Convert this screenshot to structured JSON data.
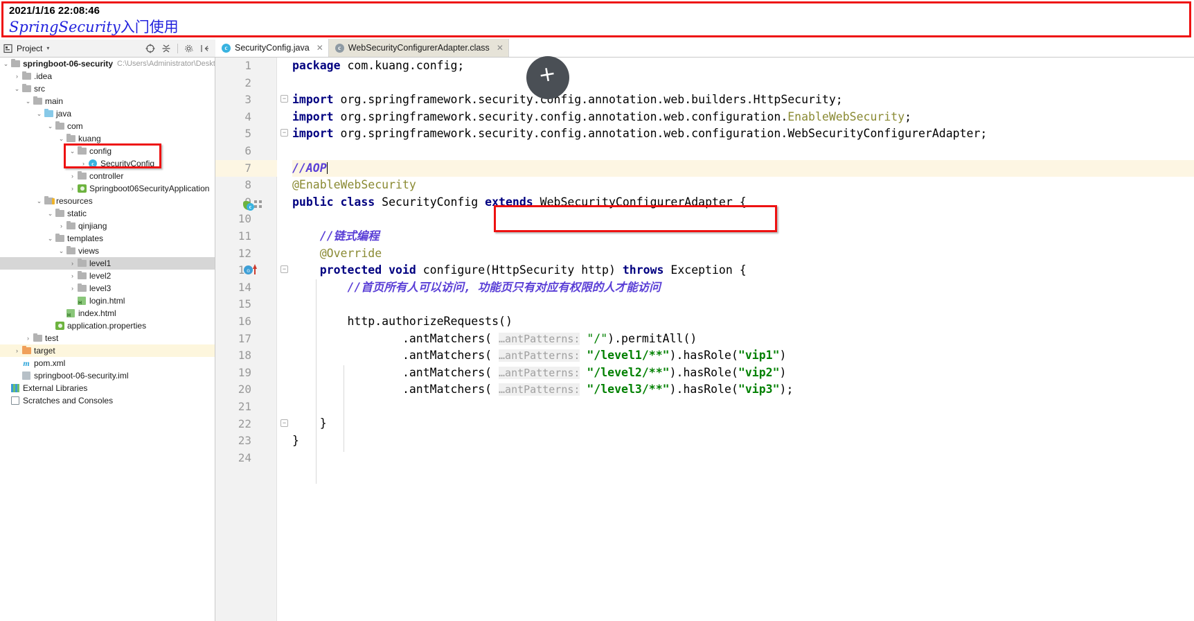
{
  "annotation": {
    "timestamp": "2021/1/16 22:08:46",
    "title_latin": "SpringSecurity",
    "title_cjk": "入门使用",
    "box_color": "#ee1111"
  },
  "project_panel": {
    "title": "Project",
    "caret": "▾",
    "toolbar_icons": [
      "target-icon",
      "collapse-all-icon",
      "settings-icon",
      "hide-icon"
    ],
    "tree": [
      {
        "depth": 0,
        "arrow": "v",
        "icon": "module-icon",
        "label": "springboot-06-security",
        "bold": true,
        "path": "C:\\Users\\Administrator\\Desktop\\"
      },
      {
        "depth": 1,
        "arrow": ">",
        "icon": "folder-icon",
        "label": ".idea"
      },
      {
        "depth": 1,
        "arrow": "v",
        "icon": "folder-icon",
        "label": "src"
      },
      {
        "depth": 2,
        "arrow": "v",
        "icon": "folder-icon",
        "label": "main"
      },
      {
        "depth": 3,
        "arrow": "v",
        "icon": "folder-blue-icon",
        "label": "java"
      },
      {
        "depth": 4,
        "arrow": "v",
        "icon": "folder-icon",
        "label": "com"
      },
      {
        "depth": 5,
        "arrow": "v",
        "icon": "folder-icon",
        "label": "kuang"
      },
      {
        "depth": 6,
        "arrow": "v",
        "icon": "folder-icon",
        "label": "config"
      },
      {
        "depth": 7,
        "arrow": ">",
        "icon": "java-class-icon",
        "label": "SecurityConfig"
      },
      {
        "depth": 6,
        "arrow": ">",
        "icon": "folder-icon",
        "label": "controller"
      },
      {
        "depth": 6,
        "arrow": ">",
        "icon": "spring-boot-icon",
        "label": "Springboot06SecurityApplication"
      },
      {
        "depth": 3,
        "arrow": "v",
        "icon": "resources-icon",
        "label": "resources"
      },
      {
        "depth": 4,
        "arrow": "v",
        "icon": "folder-icon",
        "label": "static"
      },
      {
        "depth": 5,
        "arrow": ">",
        "icon": "folder-icon",
        "label": "qinjiang"
      },
      {
        "depth": 4,
        "arrow": "v",
        "icon": "folder-icon",
        "label": "templates"
      },
      {
        "depth": 5,
        "arrow": "v",
        "icon": "folder-icon",
        "label": "views"
      },
      {
        "depth": 6,
        "arrow": ">",
        "icon": "folder-icon",
        "label": "level1",
        "selected": true
      },
      {
        "depth": 6,
        "arrow": ">",
        "icon": "folder-icon",
        "label": "level2"
      },
      {
        "depth": 6,
        "arrow": ">",
        "icon": "folder-icon",
        "label": "level3"
      },
      {
        "depth": 6,
        "arrow": "",
        "icon": "html-file-icon",
        "label": "login.html"
      },
      {
        "depth": 5,
        "arrow": "",
        "icon": "html-file-icon",
        "label": "index.html"
      },
      {
        "depth": 4,
        "arrow": "",
        "icon": "spring-properties-icon",
        "label": "application.properties"
      },
      {
        "depth": 2,
        "arrow": ">",
        "icon": "folder-icon",
        "label": "test"
      },
      {
        "depth": 1,
        "arrow": ">",
        "icon": "folder-orange-icon",
        "label": "target",
        "highlight": true
      },
      {
        "depth": 1,
        "arrow": "",
        "icon": "maven-icon",
        "label": "pom.xml"
      },
      {
        "depth": 1,
        "arrow": "",
        "icon": "iml-icon",
        "label": "springboot-06-security.iml"
      },
      {
        "depth": 0,
        "arrow": "",
        "icon": "external-libraries-icon",
        "label": "External Libraries"
      },
      {
        "depth": 0,
        "arrow": "",
        "icon": "scratches-icon",
        "label": "Scratches and Consoles"
      }
    ]
  },
  "tabs": [
    {
      "label": "SecurityConfig.java",
      "icon": "java-class-icon",
      "active": true,
      "closable": true
    },
    {
      "label": "WebSecurityConfigurerAdapter.class",
      "icon": "class-file-icon",
      "active": false,
      "closable": true
    }
  ],
  "editor": {
    "current_line": 7,
    "lines": [
      {
        "n": 1,
        "tokens": [
          {
            "t": "package ",
            "c": "kw"
          },
          {
            "t": "com.kuang.config;",
            "c": ""
          }
        ]
      },
      {
        "n": 2,
        "tokens": []
      },
      {
        "n": 3,
        "tokens": [
          {
            "t": "import ",
            "c": "kw"
          },
          {
            "t": "org.springframework.security.config.annotation.web.builders.HttpSecurity;",
            "c": ""
          }
        ]
      },
      {
        "n": 4,
        "tokens": [
          {
            "t": "import ",
            "c": "kw"
          },
          {
            "t": "org.springframework.security.config.annotation.web.configuration.",
            "c": ""
          },
          {
            "t": "EnableWebSecurity",
            "c": "ann"
          },
          {
            "t": ";",
            "c": ""
          }
        ]
      },
      {
        "n": 5,
        "tokens": [
          {
            "t": "import ",
            "c": "kw"
          },
          {
            "t": "org.springframework.security.config.annotation.web.configuration.WebSecurityConfigurerAdapter;",
            "c": ""
          }
        ]
      },
      {
        "n": 6,
        "tokens": []
      },
      {
        "n": 7,
        "tokens": [
          {
            "t": "//AOP",
            "c": "cmt-b"
          }
        ],
        "highlight": true,
        "caret": true
      },
      {
        "n": 8,
        "tokens": [
          {
            "t": "@EnableWebSecurity",
            "c": "ann"
          }
        ]
      },
      {
        "n": 9,
        "tokens": [
          {
            "t": "public ",
            "c": "kw"
          },
          {
            "t": "class ",
            "c": "kw"
          },
          {
            "t": "SecurityConfig ",
            "c": ""
          },
          {
            "t": "extends ",
            "c": "kw"
          },
          {
            "t": "WebSecurityConfigurerAdapter ",
            "c": ""
          },
          {
            "t": "{",
            "c": ""
          }
        ]
      },
      {
        "n": 10,
        "tokens": []
      },
      {
        "n": 11,
        "tokens": [
          {
            "t": "    //链式编程",
            "c": "cmt-b"
          }
        ]
      },
      {
        "n": 12,
        "tokens": [
          {
            "t": "    @Override",
            "c": "ann"
          }
        ]
      },
      {
        "n": 13,
        "tokens": [
          {
            "t": "    protected ",
            "c": "kw"
          },
          {
            "t": "void ",
            "c": "kw"
          },
          {
            "t": "configure(HttpSecurity http) ",
            "c": ""
          },
          {
            "t": "throws ",
            "c": "kw"
          },
          {
            "t": "Exception {",
            "c": ""
          }
        ]
      },
      {
        "n": 14,
        "tokens": [
          {
            "t": "        //首页所有人可以访问, 功能页只有对应有权限的人才能访问",
            "c": "cmt-b"
          }
        ]
      },
      {
        "n": 15,
        "tokens": []
      },
      {
        "n": 16,
        "tokens": [
          {
            "t": "        http.authorizeRequests()",
            "c": ""
          }
        ]
      },
      {
        "n": 17,
        "tokens": [
          {
            "t": "                .antMatchers( ",
            "c": ""
          },
          {
            "t": "…antPatterns:",
            "c": "hint"
          },
          {
            "t": " ",
            "c": ""
          },
          {
            "t": "\"/\"",
            "c": "str-p"
          },
          {
            "t": ").permitAll()",
            "c": ""
          }
        ]
      },
      {
        "n": 18,
        "tokens": [
          {
            "t": "                .antMatchers( ",
            "c": ""
          },
          {
            "t": "…antPatterns:",
            "c": "hint"
          },
          {
            "t": " ",
            "c": ""
          },
          {
            "t": "\"/level1/**\"",
            "c": "str"
          },
          {
            "t": ").hasRole(",
            "c": ""
          },
          {
            "t": "\"vip1\"",
            "c": "str"
          },
          {
            "t": ")",
            "c": ""
          }
        ]
      },
      {
        "n": 19,
        "tokens": [
          {
            "t": "                .antMatchers( ",
            "c": ""
          },
          {
            "t": "…antPatterns:",
            "c": "hint"
          },
          {
            "t": " ",
            "c": ""
          },
          {
            "t": "\"/level2/**\"",
            "c": "str"
          },
          {
            "t": ").hasRole(",
            "c": ""
          },
          {
            "t": "\"vip2\"",
            "c": "str"
          },
          {
            "t": ")",
            "c": ""
          }
        ]
      },
      {
        "n": 20,
        "tokens": [
          {
            "t": "                .antMatchers( ",
            "c": ""
          },
          {
            "t": "…antPatterns:",
            "c": "hint"
          },
          {
            "t": " ",
            "c": ""
          },
          {
            "t": "\"/level3/**\"",
            "c": "str"
          },
          {
            "t": ").hasRole(",
            "c": ""
          },
          {
            "t": "\"vip3\"",
            "c": "str"
          },
          {
            "t": ");",
            "c": ""
          }
        ]
      },
      {
        "n": 21,
        "tokens": []
      },
      {
        "n": 22,
        "tokens": [
          {
            "t": "    }",
            "c": ""
          }
        ]
      },
      {
        "n": 23,
        "tokens": [
          {
            "t": "}",
            "c": ""
          }
        ]
      },
      {
        "n": 24,
        "tokens": []
      }
    ]
  }
}
